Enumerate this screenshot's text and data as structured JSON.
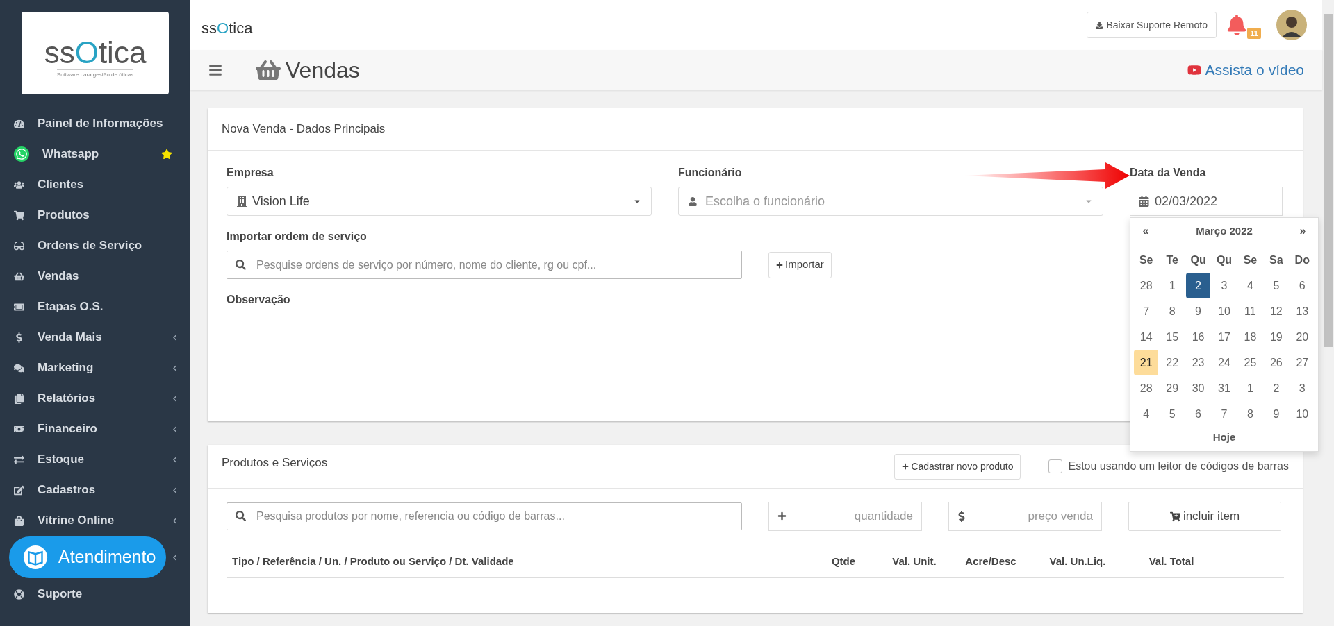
{
  "sidebar": {
    "logo": {
      "name": "ssOtica",
      "tagline": "Software para gestão de óticas"
    },
    "items": [
      {
        "label": "Painel de Informações",
        "has_submenu": false,
        "starred": false
      },
      {
        "label": "Whatsapp",
        "has_submenu": false,
        "starred": true
      },
      {
        "label": "Clientes",
        "has_submenu": false,
        "starred": false
      },
      {
        "label": "Produtos",
        "has_submenu": false,
        "starred": false
      },
      {
        "label": "Ordens de Serviço",
        "has_submenu": false,
        "starred": false
      },
      {
        "label": "Vendas",
        "has_submenu": false,
        "starred": false
      },
      {
        "label": "Etapas O.S.",
        "has_submenu": false,
        "starred": false
      },
      {
        "label": "Venda Mais",
        "has_submenu": true,
        "starred": false
      },
      {
        "label": "Marketing",
        "has_submenu": true,
        "starred": false
      },
      {
        "label": "Relatórios",
        "has_submenu": true,
        "starred": false
      },
      {
        "label": "Financeiro",
        "has_submenu": true,
        "starred": false
      },
      {
        "label": "Estoque",
        "has_submenu": true,
        "starred": false
      },
      {
        "label": "Cadastros",
        "has_submenu": true,
        "starred": false
      },
      {
        "label": "Vitrine Online",
        "has_submenu": true,
        "starred": false
      },
      {
        "label": "Suporte",
        "has_submenu": false,
        "starred": false
      }
    ],
    "chat_button": "Atendimento"
  },
  "topbar": {
    "logo": "ssOtica",
    "remote_support_button": "Baixar Suporte Remoto",
    "notifications_count": "11"
  },
  "page_header": {
    "title": "Vendas",
    "video_link": "Assista o vídeo"
  },
  "sale_card": {
    "title": "Nova Venda - Dados Principais",
    "company": {
      "label": "Empresa",
      "value": "Vision Life"
    },
    "employee": {
      "label": "Funcionário",
      "placeholder": "Escolha o funcionário"
    },
    "date": {
      "label": "Data da Venda",
      "value": "02/03/2022"
    },
    "import": {
      "label": "Importar ordem de serviço",
      "placeholder": "Pesquise ordens de serviço por número, nome do cliente, rg ou cpf...",
      "button": "Importar"
    },
    "notes": {
      "label": "Observação"
    }
  },
  "datepicker": {
    "prev": "«",
    "title": "Março 2022",
    "next": "»",
    "weekdays": [
      "Se",
      "Te",
      "Qu",
      "Qu",
      "Se",
      "Sa",
      "Do"
    ],
    "weeks": [
      [
        {
          "day": "28",
          "selected": false,
          "today": false
        },
        {
          "day": "1",
          "selected": false,
          "today": false
        },
        {
          "day": "2",
          "selected": true,
          "today": false
        },
        {
          "day": "3",
          "selected": false,
          "today": false
        },
        {
          "day": "4",
          "selected": false,
          "today": false
        },
        {
          "day": "5",
          "selected": false,
          "today": false
        },
        {
          "day": "6",
          "selected": false,
          "today": false
        }
      ],
      [
        {
          "day": "7",
          "selected": false,
          "today": false
        },
        {
          "day": "8",
          "selected": false,
          "today": false
        },
        {
          "day": "9",
          "selected": false,
          "today": false
        },
        {
          "day": "10",
          "selected": false,
          "today": false
        },
        {
          "day": "11",
          "selected": false,
          "today": false
        },
        {
          "day": "12",
          "selected": false,
          "today": false
        },
        {
          "day": "13",
          "selected": false,
          "today": false
        }
      ],
      [
        {
          "day": "14",
          "selected": false,
          "today": false
        },
        {
          "day": "15",
          "selected": false,
          "today": false
        },
        {
          "day": "16",
          "selected": false,
          "today": false
        },
        {
          "day": "17",
          "selected": false,
          "today": false
        },
        {
          "day": "18",
          "selected": false,
          "today": false
        },
        {
          "day": "19",
          "selected": false,
          "today": false
        },
        {
          "day": "20",
          "selected": false,
          "today": false
        }
      ],
      [
        {
          "day": "21",
          "selected": false,
          "today": true
        },
        {
          "day": "22",
          "selected": false,
          "today": false
        },
        {
          "day": "23",
          "selected": false,
          "today": false
        },
        {
          "day": "24",
          "selected": false,
          "today": false
        },
        {
          "day": "25",
          "selected": false,
          "today": false
        },
        {
          "day": "26",
          "selected": false,
          "today": false
        },
        {
          "day": "27",
          "selected": false,
          "today": false
        }
      ],
      [
        {
          "day": "28",
          "selected": false,
          "today": false
        },
        {
          "day": "29",
          "selected": false,
          "today": false
        },
        {
          "day": "30",
          "selected": false,
          "today": false
        },
        {
          "day": "31",
          "selected": false,
          "today": false
        },
        {
          "day": "1",
          "selected": false,
          "today": false
        },
        {
          "day": "2",
          "selected": false,
          "today": false
        },
        {
          "day": "3",
          "selected": false,
          "today": false
        }
      ],
      [
        {
          "day": "4",
          "selected": false,
          "today": false
        },
        {
          "day": "5",
          "selected": false,
          "today": false
        },
        {
          "day": "6",
          "selected": false,
          "today": false
        },
        {
          "day": "7",
          "selected": false,
          "today": false
        },
        {
          "day": "8",
          "selected": false,
          "today": false
        },
        {
          "day": "9",
          "selected": false,
          "today": false
        },
        {
          "day": "10",
          "selected": false,
          "today": false
        }
      ]
    ],
    "today_button": "Hoje"
  },
  "products_card": {
    "title": "Produtos e Serviços",
    "new_product_button": "Cadastrar novo produto",
    "barcode_reader": {
      "label": "Estou usando um leitor de códigos de barras",
      "checked": false
    },
    "search_placeholder": "Pesquisa produtos por nome, referencia ou código de barras...",
    "quantity_placeholder": "quantidade",
    "price_placeholder": "preço venda",
    "add_button": "incluir item",
    "columns": [
      "Tipo / Referência / Un. / Produto ou Serviço / Dt. Validade",
      "Qtde",
      "Val. Unit.",
      "Acre/Desc",
      "Val. Un.Liq.",
      "Val. Total"
    ]
  }
}
